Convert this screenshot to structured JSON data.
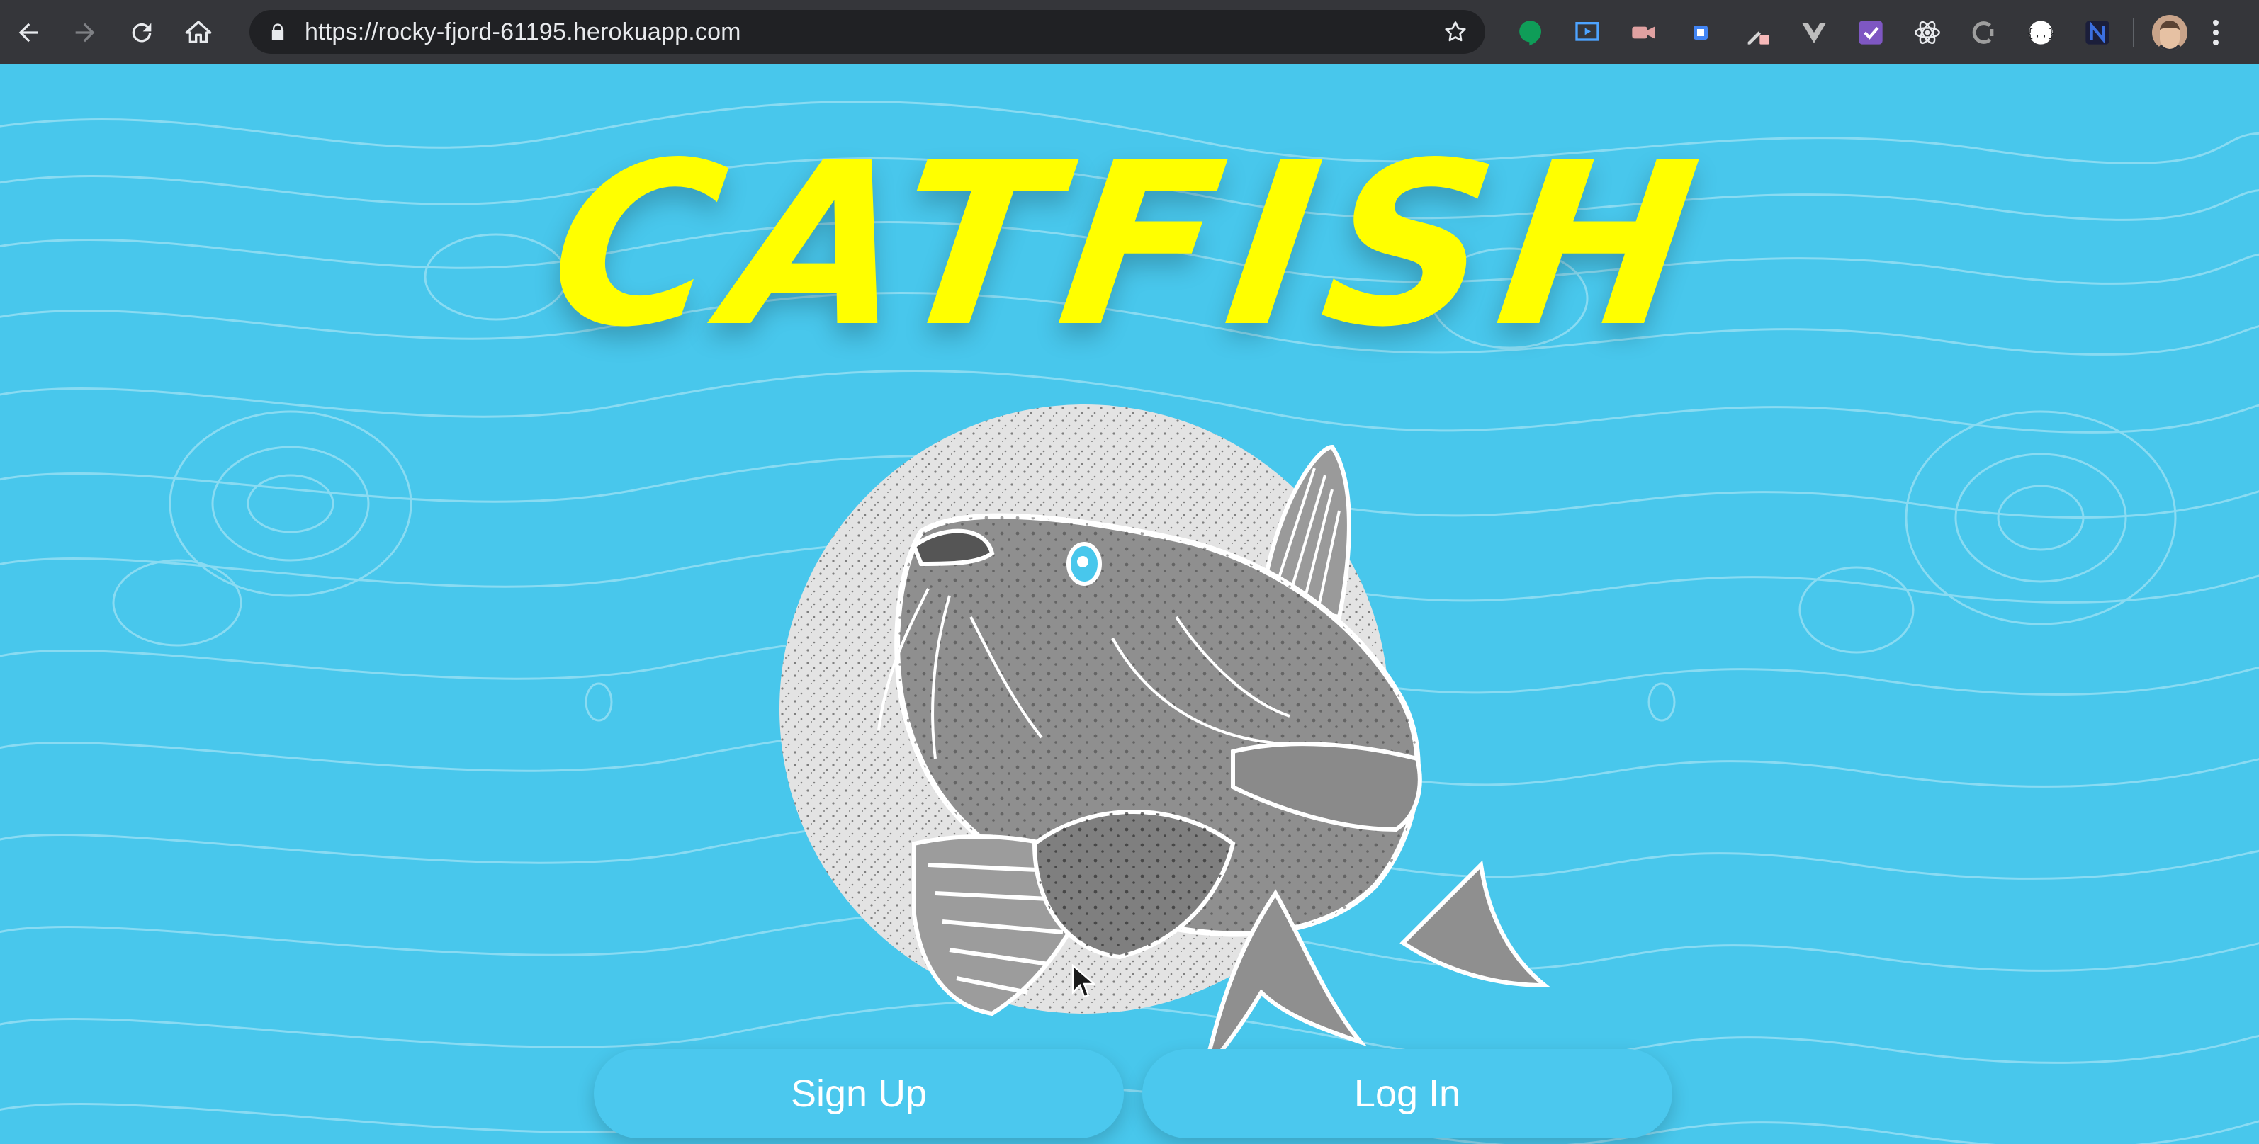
{
  "browser": {
    "url": "https://rocky-fjord-61195.herokuapp.com",
    "nav_icons": [
      "back-icon",
      "forward-icon",
      "reload-icon",
      "home-icon"
    ],
    "extension_icons": [
      "hangouts-icon",
      "screencast-icon",
      "video-record-icon",
      "square-icon",
      "eyedropper-icon",
      "vue-icon",
      "checkmark-icon",
      "react-icon",
      "c-icon",
      "json-icon",
      "n-icon"
    ]
  },
  "page": {
    "logo_text": "CATFISH",
    "signup_label": "Sign Up",
    "login_label": "Log In"
  },
  "colors": {
    "page_bg": "#48c7ec",
    "logo": "#ffff00",
    "fish_body": "#8f8f8f",
    "fish_circle": "#e3e3e3"
  }
}
